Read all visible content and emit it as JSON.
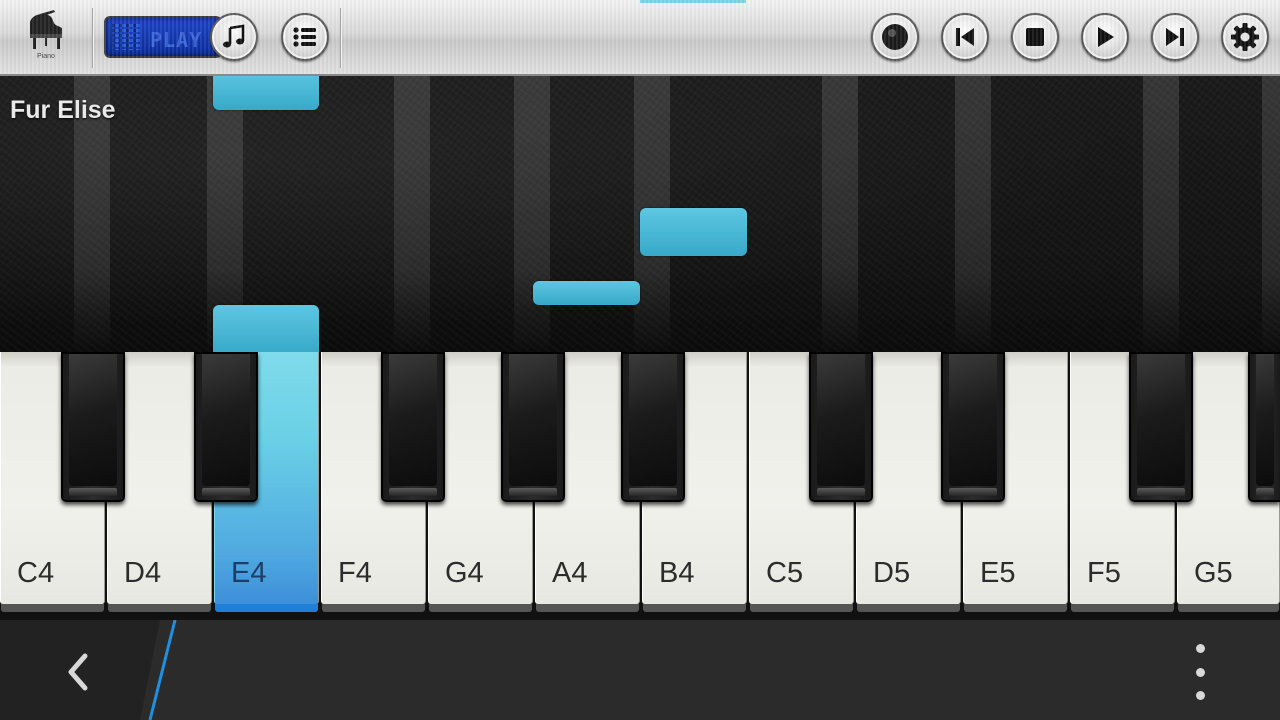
{
  "toolbar": {
    "instrument_caption": "Piano",
    "mode_display": "PLAY",
    "accent_color": "#7fd3ea",
    "buttons": [
      {
        "name": "song-button",
        "icon": "music-note-icon"
      },
      {
        "name": "song-list-button",
        "icon": "list-icon"
      },
      {
        "name": "record-button",
        "icon": "record-icon"
      },
      {
        "name": "previous-button",
        "icon": "skip-back-icon"
      },
      {
        "name": "stop-button",
        "icon": "stop-icon"
      },
      {
        "name": "play-button",
        "icon": "play-icon"
      },
      {
        "name": "next-button",
        "icon": "skip-forward-icon"
      },
      {
        "name": "settings-button",
        "icon": "gear-icon"
      }
    ]
  },
  "song": {
    "title": "Fur Elise"
  },
  "keyboard": {
    "active_key": "E4",
    "active_color": "#4fa9e0",
    "white_keys": [
      "C4",
      "D4",
      "E4",
      "F4",
      "G4",
      "A4",
      "B4",
      "C5",
      "D5",
      "E5",
      "F5",
      "G5"
    ]
  },
  "navigation": {
    "back_icon": "chevron-left-icon",
    "overflow_icon": "more-vertical-icon"
  }
}
